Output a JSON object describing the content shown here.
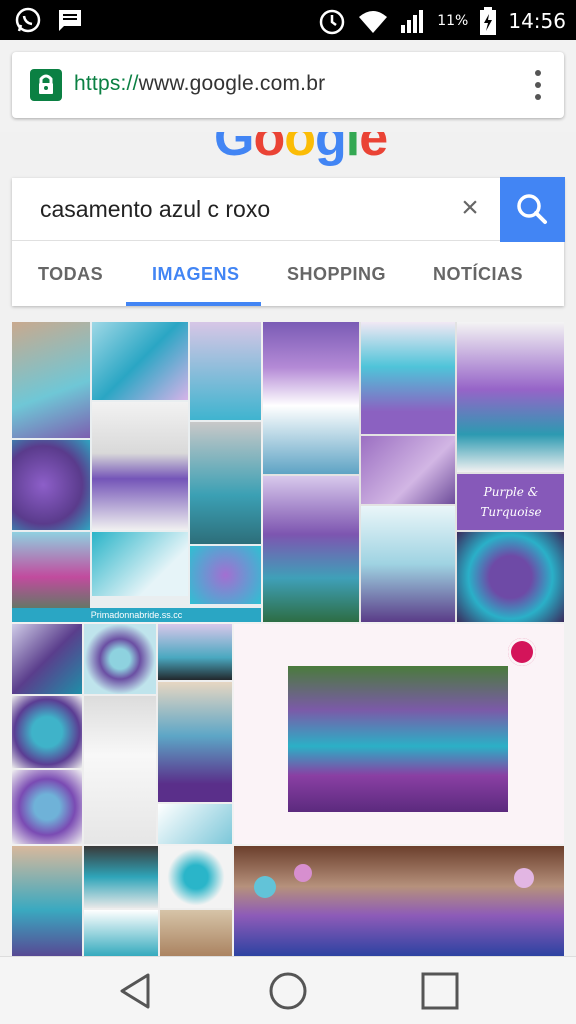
{
  "status_bar": {
    "time": "14:56",
    "battery": "11%",
    "icons": [
      "whatsapp-icon",
      "message-icon",
      "alarm-icon",
      "wifi-icon",
      "signal-icon",
      "battery-icon"
    ]
  },
  "browser": {
    "url_scheme": "https://",
    "url_host": "www.google.com.br",
    "lock_color": "#0b8043"
  },
  "search": {
    "logo_text": "Google",
    "query": "casamento azul c roxo",
    "clear_glyph": "×",
    "button_color": "#4285f4"
  },
  "tabs": [
    {
      "label": "TODAS",
      "active": false
    },
    {
      "label": "IMAGENS",
      "active": true
    },
    {
      "label": "SHOPPING",
      "active": false
    },
    {
      "label": "NOTÍCIAS",
      "active": false
    }
  ],
  "results": {
    "tile_captions": [
      "Purple & Turquoise",
      "Primadonnabride.ss.cc"
    ]
  },
  "nav_bar": {
    "buttons": [
      "back-icon",
      "home-icon",
      "recents-icon"
    ]
  }
}
